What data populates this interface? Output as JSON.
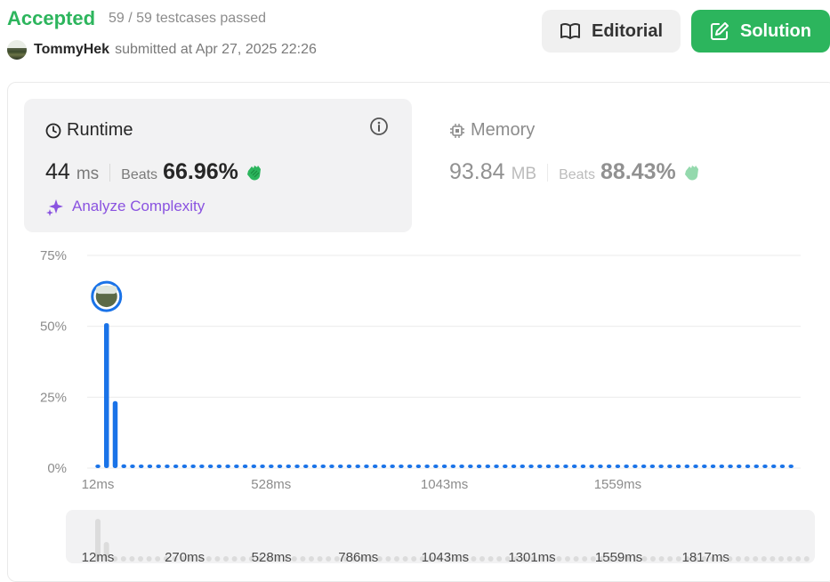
{
  "header": {
    "status": "Accepted",
    "testcases": "59 / 59 testcases passed",
    "username": "TommyHek",
    "submitted_text": "submitted at Apr 27, 2025 22:26"
  },
  "buttons": {
    "editorial": "Editorial",
    "solution": "Solution"
  },
  "runtime": {
    "title": "Runtime",
    "value": "44",
    "unit": "ms",
    "beats_label": "Beats",
    "beats_value": "66.96%",
    "analyze_label": "Analyze Complexity"
  },
  "memory": {
    "title": "Memory",
    "value": "93.84",
    "unit": "MB",
    "beats_label": "Beats",
    "beats_value": "88.43%"
  },
  "colors": {
    "accent_green": "#2cb55d",
    "bar_blue": "#1a73e8",
    "analyze_purple": "#8a53e0"
  },
  "chart_data": {
    "type": "bar",
    "title": "",
    "xlabel": "",
    "ylabel": "",
    "y_ticks": [
      "75%",
      "50%",
      "25%",
      "0%"
    ],
    "ylim": [
      0,
      75
    ],
    "x_tick_labels": [
      "12ms",
      "528ms",
      "1043ms",
      "1559ms"
    ],
    "bars": [
      {
        "x": 12,
        "y": 0.5
      },
      {
        "x": 44,
        "y": 50.5
      },
      {
        "x": 78,
        "y": 23
      },
      {
        "x": 130,
        "y": 0.7
      }
    ],
    "bar_series_note": "",
    "tail_bar_value": 0.5,
    "highlight_x": 44
  },
  "overview": {
    "tick_labels": [
      "12ms",
      "270ms",
      "528ms",
      "786ms",
      "1043ms",
      "1301ms",
      "1559ms",
      "1817ms"
    ]
  }
}
